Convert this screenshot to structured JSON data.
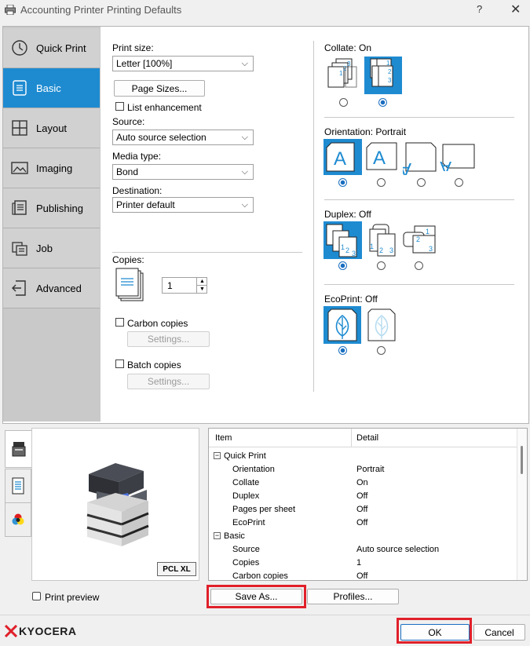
{
  "window": {
    "title": "Accounting Printer Printing Defaults",
    "help": "?",
    "close": "✕"
  },
  "sidebar": {
    "items": [
      {
        "label": "Quick Print",
        "icon": "clock-icon",
        "active": false
      },
      {
        "label": "Basic",
        "icon": "document-icon",
        "active": true
      },
      {
        "label": "Layout",
        "icon": "layout-grid-icon",
        "active": false
      },
      {
        "label": "Imaging",
        "icon": "image-icon",
        "active": false
      },
      {
        "label": "Publishing",
        "icon": "publishing-icon",
        "active": false
      },
      {
        "label": "Job",
        "icon": "job-icon",
        "active": false
      },
      {
        "label": "Advanced",
        "icon": "advanced-icon",
        "active": false
      }
    ]
  },
  "basic": {
    "print_size_label": "Print size:",
    "print_size_value": "Letter  [100%]",
    "page_sizes_button": "Page Sizes...",
    "list_enhancement": "List enhancement",
    "source_label": "Source:",
    "source_value": "Auto source selection",
    "media_type_label": "Media type:",
    "media_type_value": "Bond",
    "destination_label": "Destination:",
    "destination_value": "Printer default",
    "copies_label": "Copies:",
    "copies_value": "1",
    "carbon_copies": "Carbon copies",
    "carbon_settings": "Settings...",
    "batch_copies": "Batch copies",
    "batch_settings": "Settings..."
  },
  "right": {
    "collate": "Collate:  On",
    "orientation": "Orientation:  Portrait",
    "duplex": "Duplex:  Off",
    "ecoprint": "EcoPrint:  Off"
  },
  "preview": {
    "badge": "PCL XL",
    "print_preview": "Print preview"
  },
  "table": {
    "headers": [
      "Item",
      "Detail"
    ],
    "groups": [
      {
        "name": "Quick Print",
        "rows": [
          [
            "Orientation",
            "Portrait"
          ],
          [
            "Collate",
            "On"
          ],
          [
            "Duplex",
            "Off"
          ],
          [
            "Pages per sheet",
            "Off"
          ],
          [
            "EcoPrint",
            "Off"
          ]
        ]
      },
      {
        "name": "Basic",
        "rows": [
          [
            "Source",
            "Auto source selection"
          ],
          [
            "Copies",
            "1"
          ],
          [
            "Carbon copies",
            "Off"
          ]
        ]
      }
    ]
  },
  "buttons": {
    "save_as": "Save As...",
    "profiles": "Profiles...",
    "ok": "OK",
    "cancel": "Cancel"
  },
  "brand": {
    "name": "KYOCERA",
    "color": "#e0202a"
  },
  "colors": {
    "accent": "#1e8bd1",
    "highlight": "#e0202a"
  }
}
